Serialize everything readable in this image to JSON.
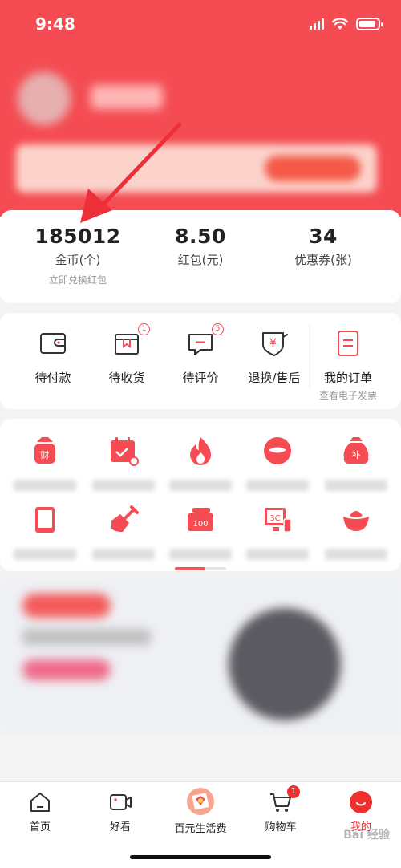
{
  "status_bar": {
    "time": "9:48"
  },
  "assets": [
    {
      "value": "185012",
      "label": "金币(个)",
      "sub": "立即兑换红包"
    },
    {
      "value": "8.50",
      "label": "红包(元)"
    },
    {
      "value": "34",
      "label": "优惠券(张)"
    }
  ],
  "orders": [
    {
      "label": "待付款",
      "icon": "wallet-icon"
    },
    {
      "label": "待收货",
      "icon": "package-icon",
      "badge": "1"
    },
    {
      "label": "待评价",
      "icon": "comment-icon",
      "badge": "5"
    },
    {
      "label": "退换/售后",
      "icon": "refund-icon"
    },
    {
      "label": "我的订单",
      "icon": "order-list-icon",
      "sub": "查看电子发票"
    }
  ],
  "tabbar": [
    {
      "label": "首页",
      "icon": "home-icon"
    },
    {
      "label": "好看",
      "icon": "video-icon"
    },
    {
      "label": "百元生活费",
      "icon": "gift-icon"
    },
    {
      "label": "购物车",
      "icon": "cart-icon",
      "badge": "1"
    },
    {
      "label": "我的",
      "icon": "profile-icon",
      "active": true
    }
  ],
  "watermark": "Bai 经验",
  "colors": {
    "brand": "#f44c52",
    "active_tab": "#f02f2f"
  }
}
